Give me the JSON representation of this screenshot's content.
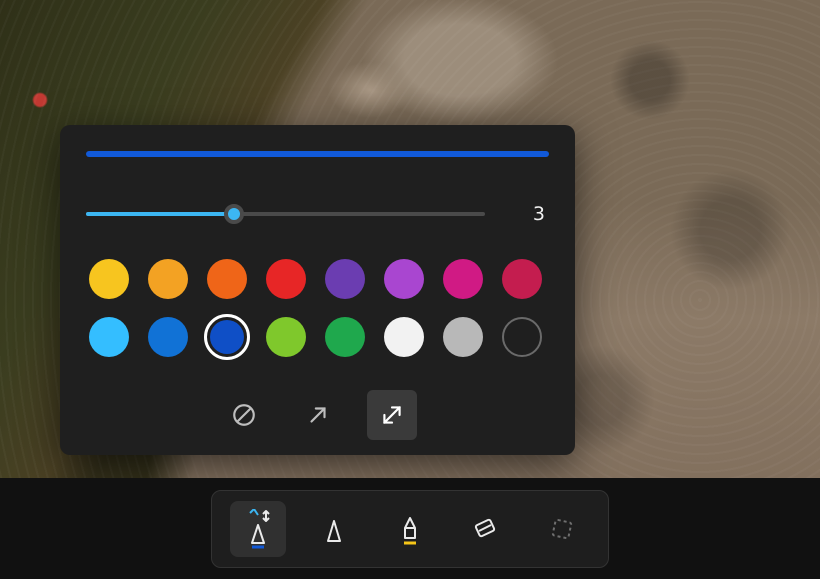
{
  "panel": {
    "preview_color": "#1159d8",
    "slider": {
      "value": 3,
      "min": 1,
      "max": 10,
      "percent": 37
    },
    "colors": {
      "row1": [
        {
          "name": "yellow",
          "hex": "#f7c51f"
        },
        {
          "name": "amber",
          "hex": "#f3a223"
        },
        {
          "name": "orange",
          "hex": "#ef6518"
        },
        {
          "name": "red",
          "hex": "#e72626"
        },
        {
          "name": "indigo",
          "hex": "#6b3db1"
        },
        {
          "name": "violet",
          "hex": "#a946d0"
        },
        {
          "name": "magenta",
          "hex": "#d01a84"
        },
        {
          "name": "crimson",
          "hex": "#c41d4f"
        }
      ],
      "row2": [
        {
          "name": "sky",
          "hex": "#34beff"
        },
        {
          "name": "azure",
          "hex": "#1172d6"
        },
        {
          "name": "blue",
          "hex": "#0f4fc6",
          "selected": true
        },
        {
          "name": "lime",
          "hex": "#7fc82c"
        },
        {
          "name": "green",
          "hex": "#1fa84d"
        },
        {
          "name": "white",
          "hex": "#f2f2f2"
        },
        {
          "name": "grey",
          "hex": "#b8b8b8"
        },
        {
          "name": "none",
          "hex": "",
          "hollow": true
        }
      ]
    },
    "tips": {
      "none_selected": false,
      "single_selected": false,
      "both_selected": true
    }
  },
  "toolbar": {
    "tools": [
      {
        "name": "pen-blue",
        "active": true,
        "accent": "#1159d8"
      },
      {
        "name": "pen",
        "active": false
      },
      {
        "name": "highlighter",
        "active": false,
        "accent": "#f5c518"
      },
      {
        "name": "eraser",
        "active": false
      },
      {
        "name": "crop",
        "active": false,
        "dim": true
      }
    ]
  }
}
